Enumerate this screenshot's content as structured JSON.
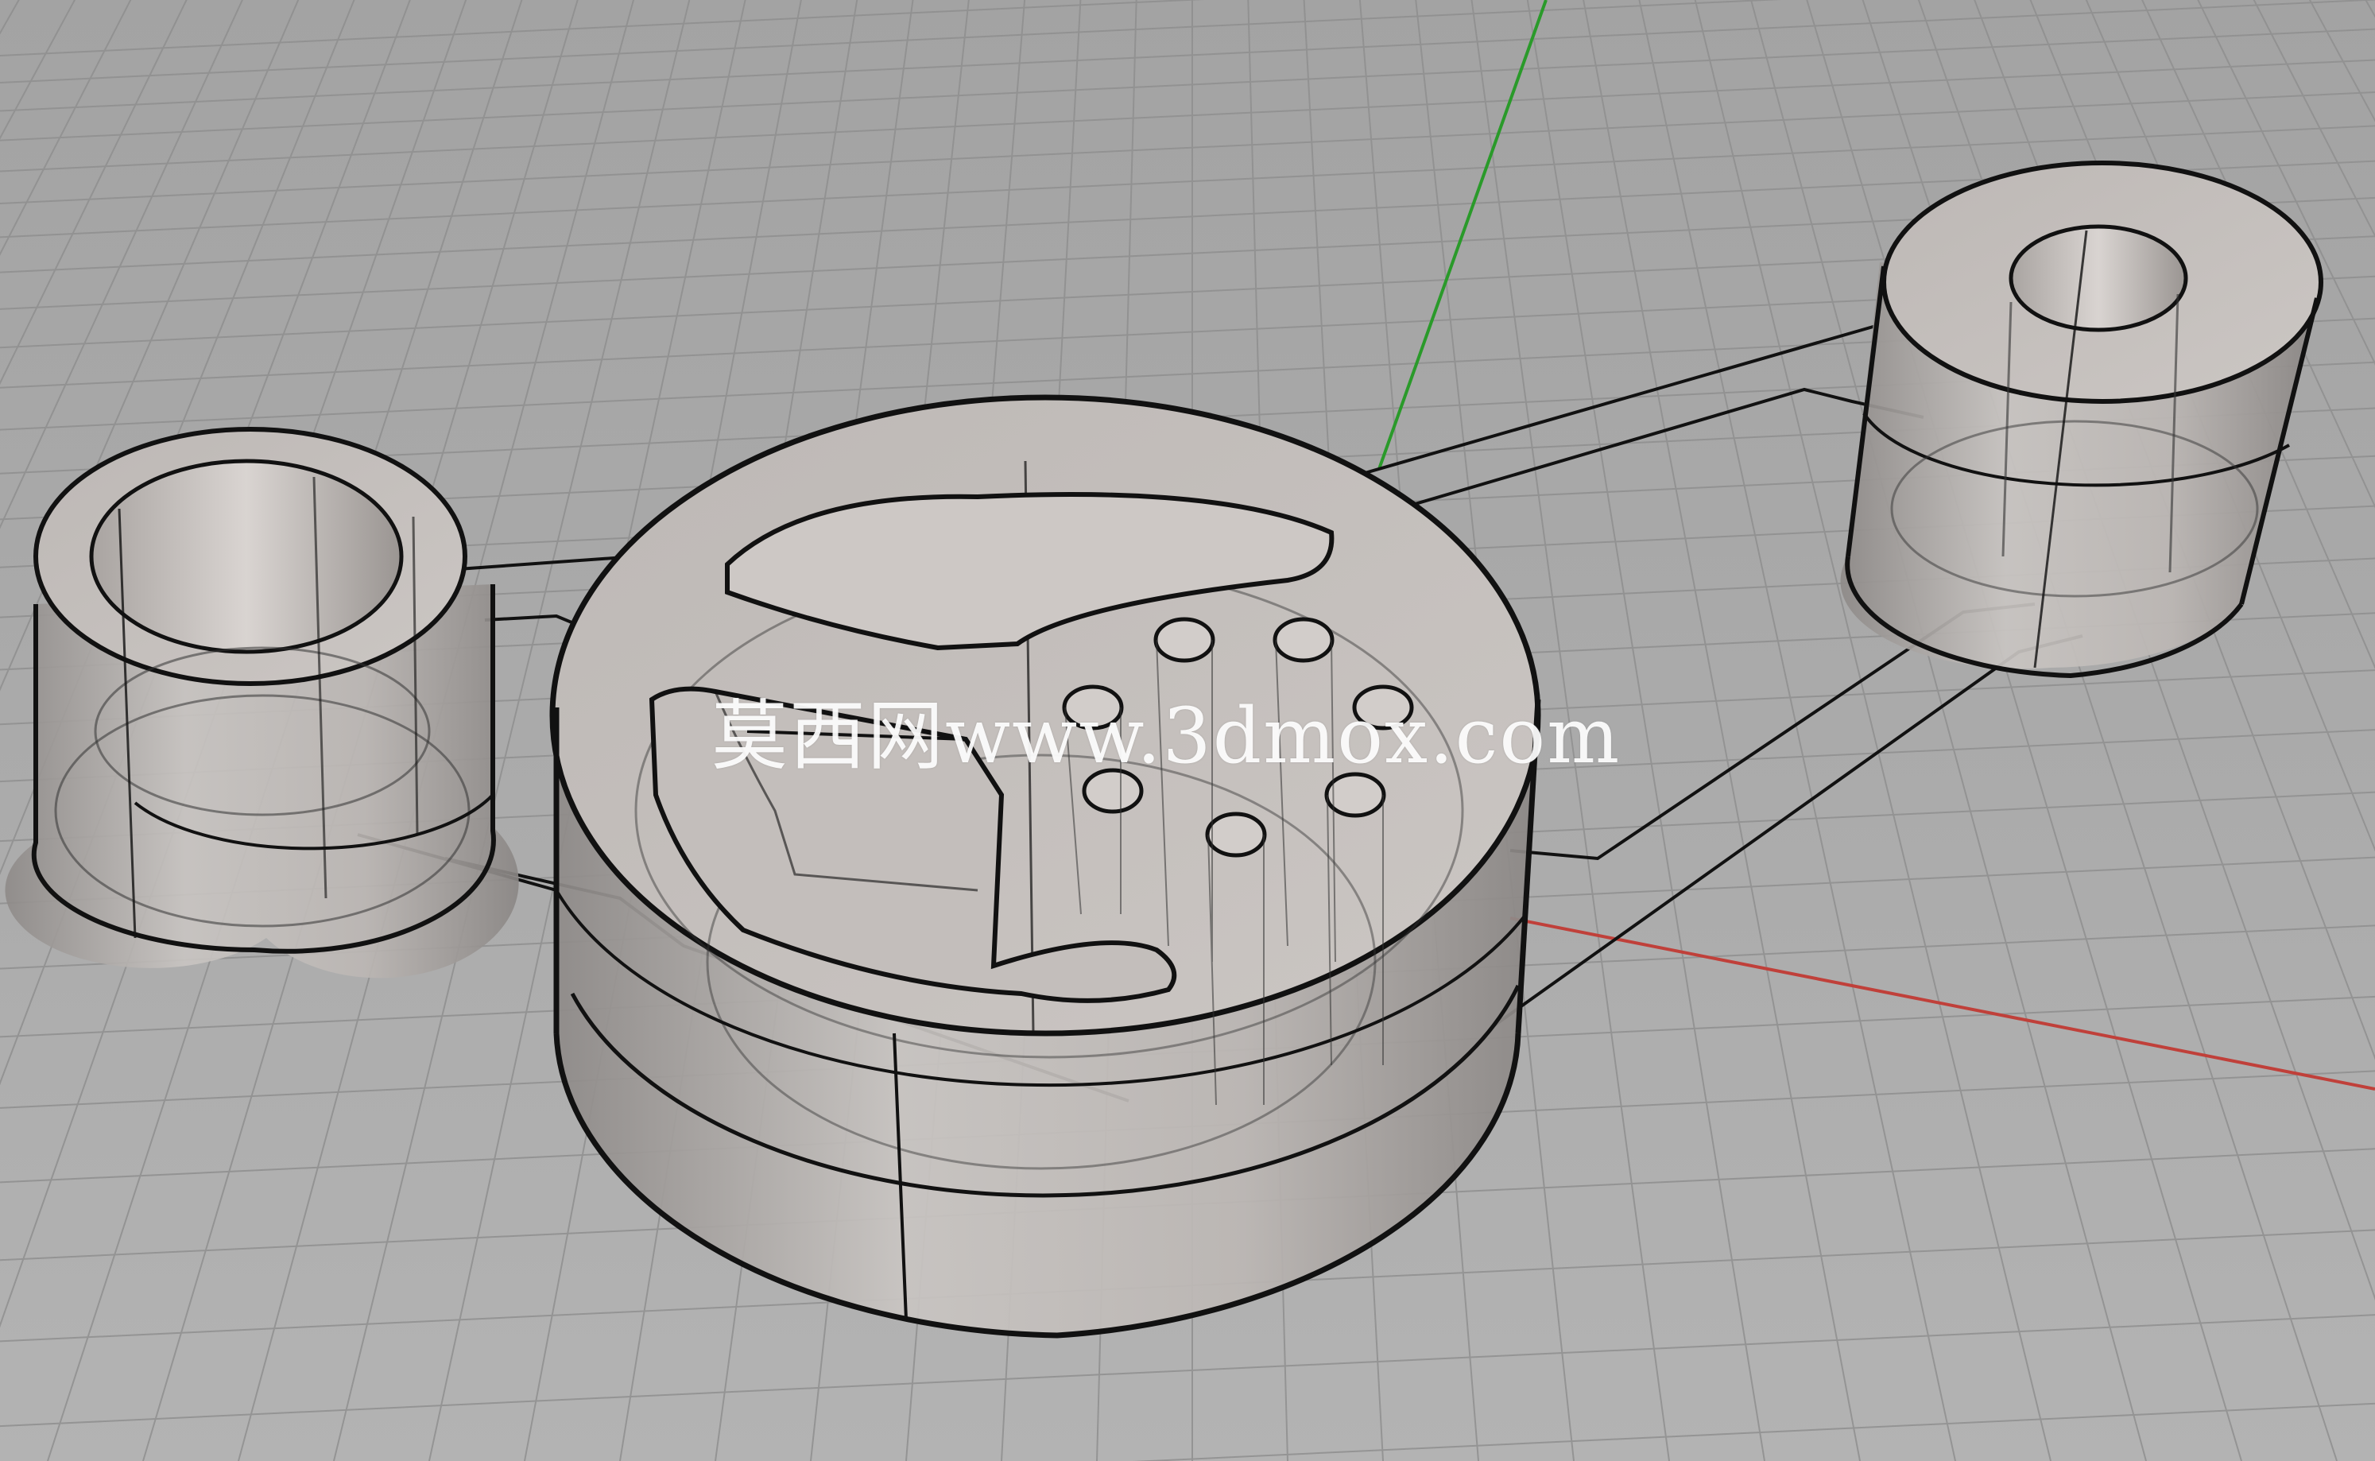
{
  "viewport": {
    "view": "Perspective",
    "display_mode": "X-ray",
    "background": "#a8a8a8",
    "grid": true,
    "grid_color": "#8f8f8f",
    "object_color": "#b9b4b1",
    "edge_color": "#111111",
    "x_axis_color": "#c0403a",
    "y_axis_color": "#2a9a2a"
  },
  "scene": {
    "objects": [
      {
        "name": "Left cylinder sleeve"
      },
      {
        "name": "Center cylinder part with seven holes"
      },
      {
        "name": "Right cylinder sleeve"
      },
      {
        "name": "Belt curve"
      }
    ]
  },
  "watermark": {
    "text": "莫西网www.3dmox.com"
  }
}
